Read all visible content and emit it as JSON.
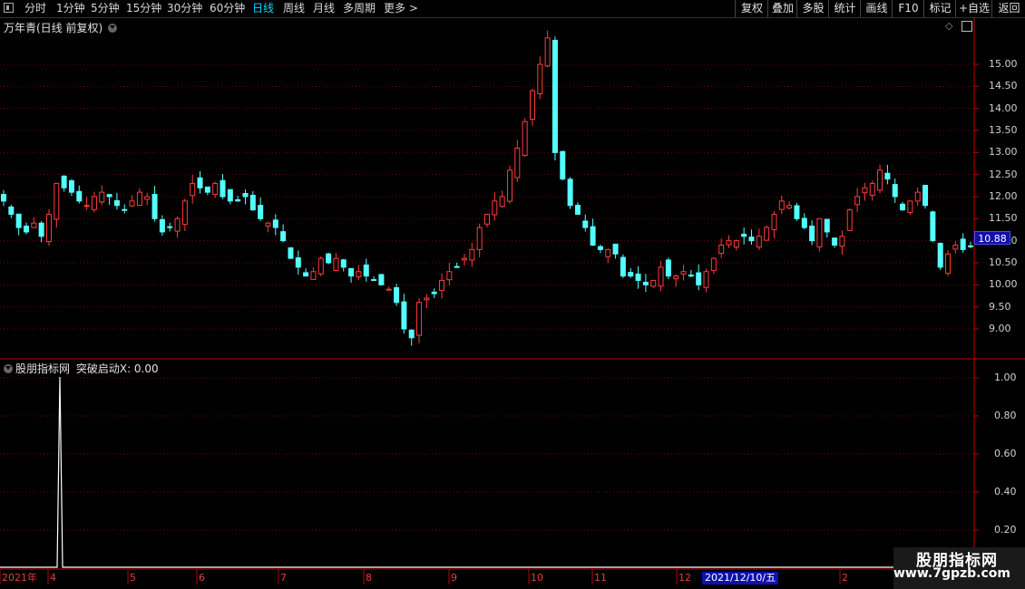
{
  "toolbar": {
    "periods": [
      "分时",
      "1分钟",
      "5分钟",
      "15分钟",
      "30分钟",
      "60分钟",
      "日线",
      "周线",
      "月线",
      "多周期",
      "更多 >"
    ],
    "active_period": "日线",
    "right_buttons": [
      "复权",
      "叠加",
      "多股",
      "统计",
      "画线",
      "F10",
      "标记",
      "+自选",
      "返回"
    ]
  },
  "main_panel": {
    "title": "万年青(日线 前复权)",
    "current_price": "10.88",
    "y_ticks": [
      "15.00",
      "14.50",
      "14.00",
      "13.50",
      "13.00",
      "12.50",
      "12.00",
      "11.50",
      "11.00",
      "10.50",
      "10.00",
      "9.50",
      "9.00"
    ]
  },
  "indicator_panel": {
    "title": "股朋指标网",
    "indicator_label": "突破启动X: 0.00",
    "y_ticks": [
      "1.00",
      "0.80",
      "0.60",
      "0.40",
      "0.20"
    ]
  },
  "x_axis": {
    "labels": [
      "2021年",
      "4",
      "5",
      "6",
      "7",
      "8",
      "9",
      "10",
      "11",
      "12",
      "2",
      "3"
    ],
    "cursor_date": "2021/12/10/五"
  },
  "watermark": {
    "name": "股朋指标网",
    "url": "www.7gpzb.com"
  },
  "colors": {
    "up": "#ff3c3c",
    "down": "#54ffff",
    "grid": "#7a0000",
    "axis": "#c00000",
    "active": "#00d8ff"
  },
  "chart_data": {
    "type": "candlestick",
    "title": "万年青(日线 前复权)",
    "ylim": [
      8.8,
      15.7
    ],
    "close_series": [
      11.9,
      11.6,
      11.3,
      11.2,
      11.4,
      11.1,
      11.6,
      12.3,
      12.2,
      12.1,
      11.9,
      11.8,
      12.0,
      12.1,
      12.0,
      11.8,
      11.7,
      11.9,
      12.1,
      12.0,
      11.5,
      11.2,
      11.3,
      11.5,
      11.9,
      12.3,
      12.2,
      12.1,
      12.3,
      12.0,
      11.9,
      11.9,
      12.0,
      11.7,
      11.5,
      11.4,
      11.3,
      11.0,
      10.6,
      10.4,
      10.2,
      10.3,
      10.6,
      10.5,
      10.6,
      10.4,
      10.2,
      10.3,
      10.2,
      10.1,
      10.0,
      9.9,
      9.6,
      9.0,
      8.8,
      9.6,
      9.7,
      9.8,
      10.1,
      10.3,
      10.4,
      10.6,
      10.8,
      11.3,
      11.6,
      11.9,
      12.0,
      12.6,
      13.1,
      13.7,
      14.4,
      15.0,
      15.6,
      13.0,
      12.4,
      11.8,
      11.6,
      11.3,
      10.9,
      10.8,
      10.8,
      10.7,
      10.2,
      10.2,
      10.1,
      10.0,
      10.1,
      10.4,
      10.2,
      10.2,
      10.3,
      10.2,
      10.0,
      10.3,
      10.6,
      10.9,
      11.0,
      11.0,
      11.1,
      11.0,
      11.1,
      11.3,
      11.6,
      11.9,
      11.8,
      11.5,
      11.3,
      11.0,
      11.5,
      11.2,
      10.9,
      11.1,
      11.7,
      12.0,
      12.2,
      12.3,
      12.6,
      12.4,
      12.0,
      11.7,
      11.9,
      12.1,
      11.8,
      11.0,
      10.4,
      10.7,
      10.9,
      10.8,
      10.88
    ]
  }
}
